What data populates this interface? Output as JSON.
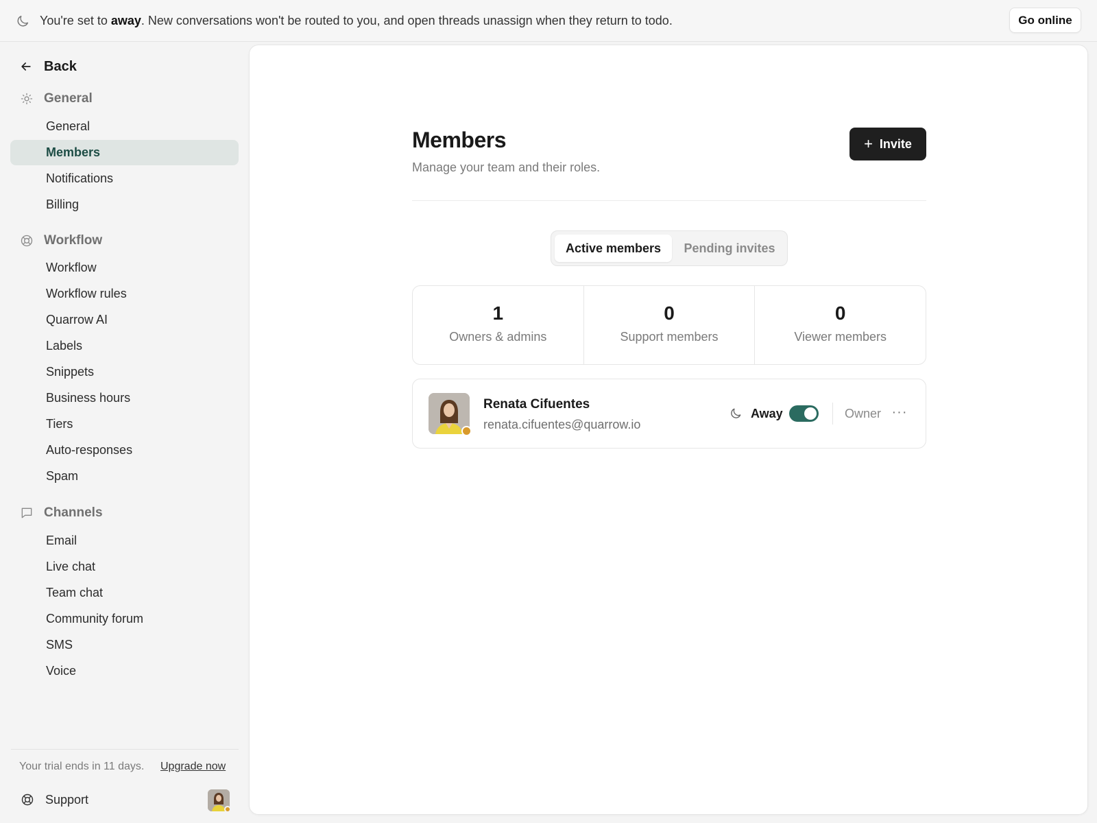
{
  "banner": {
    "icon": "moon-icon",
    "text_before": "You're set to ",
    "text_bold": "away",
    "text_after": ". New conversations won't be routed to you, and open threads unassign when they return to todo.",
    "button_label": "Go online"
  },
  "sidebar": {
    "back_label": "Back",
    "sections": [
      {
        "title": "General",
        "icon": "sun-icon",
        "items": [
          "General",
          "Members",
          "Notifications",
          "Billing"
        ]
      },
      {
        "title": "Workflow",
        "icon": "lifebuoy-icon",
        "items": [
          "Workflow",
          "Workflow rules",
          "Quarrow AI",
          "Labels",
          "Snippets",
          "Business hours",
          "Tiers",
          "Auto-responses",
          "Spam"
        ]
      },
      {
        "title": "Channels",
        "icon": "chat-bubble-icon",
        "items": [
          "Email",
          "Live chat",
          "Team chat",
          "Community forum",
          "SMS",
          "Voice"
        ]
      }
    ],
    "active_item": "Members",
    "trial_text": "Your trial ends in 11 days.",
    "upgrade_label": "Upgrade now",
    "support_label": "Support"
  },
  "main": {
    "title": "Members",
    "subtitle": "Manage your team and their roles.",
    "invite_label": "Invite",
    "tabs": [
      {
        "label": "Active members",
        "active": true
      },
      {
        "label": "Pending invites",
        "active": false
      }
    ],
    "stats": [
      {
        "value": "1",
        "label": "Owners & admins"
      },
      {
        "value": "0",
        "label": "Support members"
      },
      {
        "value": "0",
        "label": "Viewer members"
      }
    ],
    "members": [
      {
        "name": "Renata Cifuentes",
        "email": "renata.cifuentes@quarrow.io",
        "status": "Away",
        "status_color": "#d99a2b",
        "toggle_on": true,
        "role": "Owner",
        "more": "···"
      }
    ]
  },
  "colors": {
    "accent": "#2b6b60",
    "active_nav_bg": "#dfe5e3",
    "active_nav_text": "#1d4d45",
    "away_dot": "#d99a2b"
  }
}
